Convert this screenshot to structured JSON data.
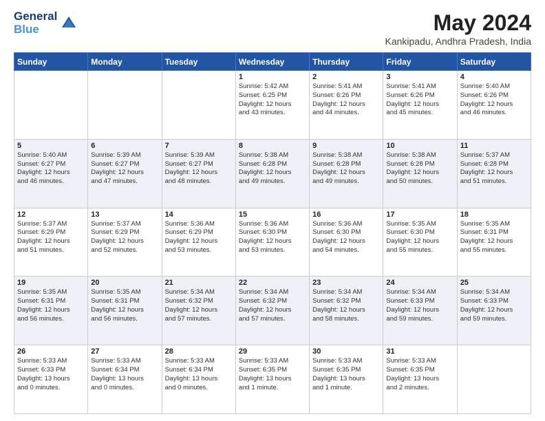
{
  "logo": {
    "line1": "General",
    "line2": "Blue"
  },
  "title": "May 2024",
  "location": "Kankipadu, Andhra Pradesh, India",
  "weekdays": [
    "Sunday",
    "Monday",
    "Tuesday",
    "Wednesday",
    "Thursday",
    "Friday",
    "Saturday"
  ],
  "weeks": [
    [
      {
        "day": "",
        "info": ""
      },
      {
        "day": "",
        "info": ""
      },
      {
        "day": "",
        "info": ""
      },
      {
        "day": "1",
        "info": "Sunrise: 5:42 AM\nSunset: 6:25 PM\nDaylight: 12 hours\nand 43 minutes."
      },
      {
        "day": "2",
        "info": "Sunrise: 5:41 AM\nSunset: 6:26 PM\nDaylight: 12 hours\nand 44 minutes."
      },
      {
        "day": "3",
        "info": "Sunrise: 5:41 AM\nSunset: 6:26 PM\nDaylight: 12 hours\nand 45 minutes."
      },
      {
        "day": "4",
        "info": "Sunrise: 5:40 AM\nSunset: 6:26 PM\nDaylight: 12 hours\nand 46 minutes."
      }
    ],
    [
      {
        "day": "5",
        "info": "Sunrise: 5:40 AM\nSunset: 6:27 PM\nDaylight: 12 hours\nand 46 minutes."
      },
      {
        "day": "6",
        "info": "Sunrise: 5:39 AM\nSunset: 6:27 PM\nDaylight: 12 hours\nand 47 minutes."
      },
      {
        "day": "7",
        "info": "Sunrise: 5:39 AM\nSunset: 6:27 PM\nDaylight: 12 hours\nand 48 minutes."
      },
      {
        "day": "8",
        "info": "Sunrise: 5:38 AM\nSunset: 6:28 PM\nDaylight: 12 hours\nand 49 minutes."
      },
      {
        "day": "9",
        "info": "Sunrise: 5:38 AM\nSunset: 6:28 PM\nDaylight: 12 hours\nand 49 minutes."
      },
      {
        "day": "10",
        "info": "Sunrise: 5:38 AM\nSunset: 6:28 PM\nDaylight: 12 hours\nand 50 minutes."
      },
      {
        "day": "11",
        "info": "Sunrise: 5:37 AM\nSunset: 6:28 PM\nDaylight: 12 hours\nand 51 minutes."
      }
    ],
    [
      {
        "day": "12",
        "info": "Sunrise: 5:37 AM\nSunset: 6:29 PM\nDaylight: 12 hours\nand 51 minutes."
      },
      {
        "day": "13",
        "info": "Sunrise: 5:37 AM\nSunset: 6:29 PM\nDaylight: 12 hours\nand 52 minutes."
      },
      {
        "day": "14",
        "info": "Sunrise: 5:36 AM\nSunset: 6:29 PM\nDaylight: 12 hours\nand 53 minutes."
      },
      {
        "day": "15",
        "info": "Sunrise: 5:36 AM\nSunset: 6:30 PM\nDaylight: 12 hours\nand 53 minutes."
      },
      {
        "day": "16",
        "info": "Sunrise: 5:36 AM\nSunset: 6:30 PM\nDaylight: 12 hours\nand 54 minutes."
      },
      {
        "day": "17",
        "info": "Sunrise: 5:35 AM\nSunset: 6:30 PM\nDaylight: 12 hours\nand 55 minutes."
      },
      {
        "day": "18",
        "info": "Sunrise: 5:35 AM\nSunset: 6:31 PM\nDaylight: 12 hours\nand 55 minutes."
      }
    ],
    [
      {
        "day": "19",
        "info": "Sunrise: 5:35 AM\nSunset: 6:31 PM\nDaylight: 12 hours\nand 56 minutes."
      },
      {
        "day": "20",
        "info": "Sunrise: 5:35 AM\nSunset: 6:31 PM\nDaylight: 12 hours\nand 56 minutes."
      },
      {
        "day": "21",
        "info": "Sunrise: 5:34 AM\nSunset: 6:32 PM\nDaylight: 12 hours\nand 57 minutes."
      },
      {
        "day": "22",
        "info": "Sunrise: 5:34 AM\nSunset: 6:32 PM\nDaylight: 12 hours\nand 57 minutes."
      },
      {
        "day": "23",
        "info": "Sunrise: 5:34 AM\nSunset: 6:32 PM\nDaylight: 12 hours\nand 58 minutes."
      },
      {
        "day": "24",
        "info": "Sunrise: 5:34 AM\nSunset: 6:33 PM\nDaylight: 12 hours\nand 59 minutes."
      },
      {
        "day": "25",
        "info": "Sunrise: 5:34 AM\nSunset: 6:33 PM\nDaylight: 12 hours\nand 59 minutes."
      }
    ],
    [
      {
        "day": "26",
        "info": "Sunrise: 5:33 AM\nSunset: 6:33 PM\nDaylight: 13 hours\nand 0 minutes."
      },
      {
        "day": "27",
        "info": "Sunrise: 5:33 AM\nSunset: 6:34 PM\nDaylight: 13 hours\nand 0 minutes."
      },
      {
        "day": "28",
        "info": "Sunrise: 5:33 AM\nSunset: 6:34 PM\nDaylight: 13 hours\nand 0 minutes."
      },
      {
        "day": "29",
        "info": "Sunrise: 5:33 AM\nSunset: 6:35 PM\nDaylight: 13 hours\nand 1 minute."
      },
      {
        "day": "30",
        "info": "Sunrise: 5:33 AM\nSunset: 6:35 PM\nDaylight: 13 hours\nand 1 minute."
      },
      {
        "day": "31",
        "info": "Sunrise: 5:33 AM\nSunset: 6:35 PM\nDaylight: 13 hours\nand 2 minutes."
      },
      {
        "day": "",
        "info": ""
      }
    ]
  ]
}
